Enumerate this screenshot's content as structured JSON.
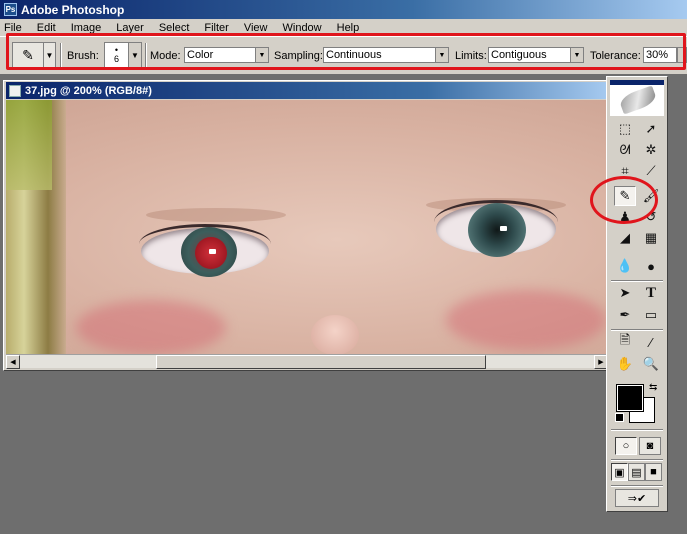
{
  "app": {
    "title": "Adobe Photoshop",
    "icon": "photoshop-app-icon"
  },
  "menu": [
    "File",
    "Edit",
    "Image",
    "Layer",
    "Select",
    "Filter",
    "View",
    "Window",
    "Help"
  ],
  "options": {
    "brush_label": "Brush:",
    "brush_size": "6",
    "mode_label": "Mode:",
    "mode_value": "Color",
    "sampling_label": "Sampling:",
    "sampling_value": "Continuous",
    "limits_label": "Limits:",
    "limits_value": "Contiguous",
    "tolerance_label": "Tolerance:",
    "tolerance_value": "30%"
  },
  "document": {
    "title": "37.jpg @ 200% (RGB/8#)"
  },
  "toolbox": {
    "tools": [
      "rectangular-marquee-icon",
      "move-icon",
      "lasso-icon",
      "magic-wand-icon",
      "crop-icon",
      "slice-icon",
      "color-replacement-brush-icon",
      "brush-icon",
      "clone-stamp-icon",
      "history-brush-icon",
      "eraser-icon",
      "gradient-icon",
      "blur-icon",
      "dodge-icon",
      "path-selection-icon",
      "type-icon",
      "pen-icon",
      "shape-icon",
      "notes-icon",
      "eyedropper-icon",
      "hand-icon",
      "zoom-icon"
    ],
    "foreground_color": "#000000",
    "background_color": "#ffffff"
  },
  "annotation_color": "#e0151c"
}
